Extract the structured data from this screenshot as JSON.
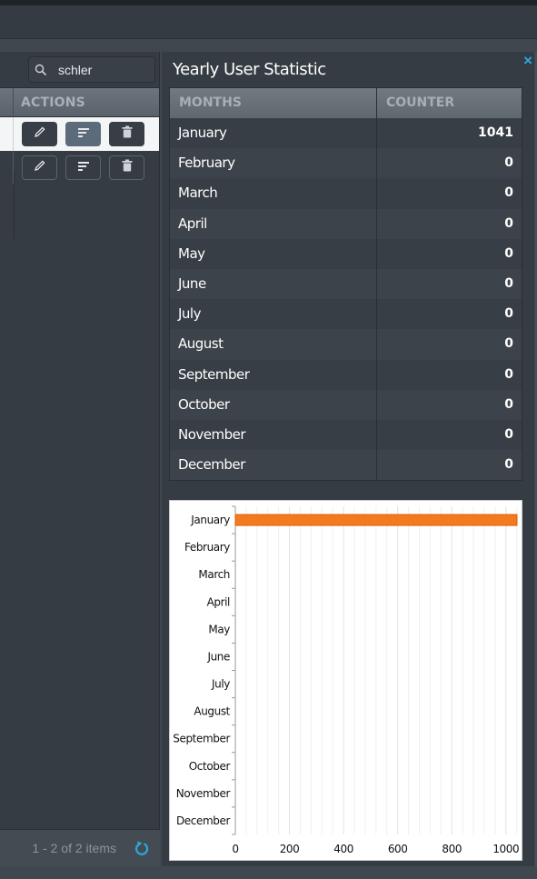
{
  "left_panel": {
    "search": {
      "value": "schler",
      "placeholder": ""
    },
    "columns": {
      "actions": "ACTIONS"
    },
    "rows": [
      {
        "selected": true,
        "actions": [
          "edit",
          "details",
          "delete"
        ]
      },
      {
        "selected": false,
        "actions": [
          "edit",
          "details",
          "delete"
        ]
      }
    ],
    "footer": {
      "pager_text": "1 - 2 of 2 items",
      "refresh_label": "refresh"
    }
  },
  "right_panel": {
    "title": "Yearly User Statistic",
    "close_label": "×",
    "table": {
      "columns": {
        "months": "MONTHS",
        "counter": "COUNTER"
      },
      "rows": [
        {
          "month": "January",
          "count": "1041"
        },
        {
          "month": "February",
          "count": "0"
        },
        {
          "month": "March",
          "count": "0"
        },
        {
          "month": "April",
          "count": "0"
        },
        {
          "month": "May",
          "count": "0"
        },
        {
          "month": "June",
          "count": "0"
        },
        {
          "month": "July",
          "count": "0"
        },
        {
          "month": "August",
          "count": "0"
        },
        {
          "month": "September",
          "count": "0"
        },
        {
          "month": "October",
          "count": "0"
        },
        {
          "month": "November",
          "count": "0"
        },
        {
          "month": "December",
          "count": "0"
        }
      ]
    }
  },
  "colors": {
    "accent": "#29a8e0",
    "bar": "#f47a20",
    "bar_edge": "#d9620e"
  },
  "chart_data": {
    "type": "bar",
    "orientation": "horizontal",
    "title": "",
    "xlabel": "",
    "ylabel": "",
    "categories": [
      "January",
      "February",
      "March",
      "April",
      "May",
      "June",
      "July",
      "August",
      "September",
      "October",
      "November",
      "December"
    ],
    "values": [
      1041,
      0,
      0,
      0,
      0,
      0,
      0,
      0,
      0,
      0,
      0,
      0
    ],
    "xlim": [
      0,
      1041
    ],
    "x_ticks": [
      0,
      200,
      400,
      600,
      800,
      1000
    ],
    "minor_grid_step": 40,
    "grid": true,
    "legend": "none"
  }
}
